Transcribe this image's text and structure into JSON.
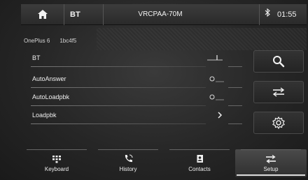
{
  "topbar": {
    "home_icon": "home-icon",
    "app_name": "BT",
    "device_title": "VRCPAA-70M",
    "bt_icon": "bluetooth-icon",
    "clock": "01:55"
  },
  "paired": {
    "device_name": "OnePlus 6",
    "device_addr": "1bc4f5"
  },
  "settings": [
    {
      "label": "BT",
      "control": "toggle-switch"
    },
    {
      "label": "AutoAnswer",
      "control": "radio"
    },
    {
      "label": "AutoLoadpbk",
      "control": "radio"
    },
    {
      "label": "Loadpbk",
      "control": "chevron-right"
    }
  ],
  "side_buttons": [
    "search-icon",
    "swap-icon",
    "settings-gear-icon"
  ],
  "nav": {
    "items": [
      {
        "label": "Keyboard",
        "icon": "keypad-icon"
      },
      {
        "label": "History",
        "icon": "phone-call-icon"
      },
      {
        "label": "Contacts",
        "icon": "contacts-book-icon"
      },
      {
        "label": "Setup",
        "icon": "swap-icon"
      }
    ],
    "active": "Setup"
  },
  "colors": {
    "background": "#262626",
    "text": "#efefef",
    "accent": "#dcdcdc"
  }
}
